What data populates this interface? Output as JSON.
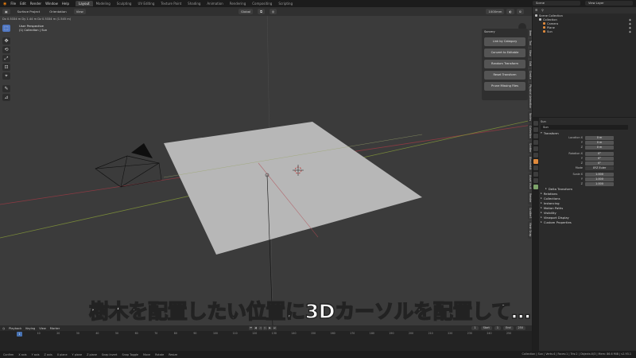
{
  "app": {
    "menu": [
      "File",
      "Edit",
      "Render",
      "Window",
      "Help"
    ],
    "workspaces": [
      "Layout",
      "Modeling",
      "Sculpting",
      "UV Editing",
      "Texture Paint",
      "Shading",
      "Animation",
      "Rendering",
      "Compositing",
      "Scripting"
    ],
    "active_workspace": "Layout",
    "scene_field": "Scene",
    "view_layer_field": "View Layer"
  },
  "viewport": {
    "header": {
      "surface_project": "Surface Project",
      "orientation_label": "Orientation",
      "view": "View",
      "transform_orientation": "Global",
      "snap_value": "1000mm"
    },
    "subheader": "Dx 0.5334 m  Dy 1.44 m  Dz 0.5334 m (1.545 m)",
    "info": {
      "perspective": "User Perspective",
      "collection": "(1) Collection | Sun"
    },
    "tools": [
      "⬚",
      "✥",
      "⟲",
      "⤢",
      "⊡",
      "⌖",
      "✎",
      "⊿"
    ],
    "npanel": {
      "title": "Sorcery",
      "buttons": [
        "Link by Category",
        "Convert to Editable",
        "Random Transform",
        "Reset Transform",
        "Prune Missing Files"
      ]
    },
    "sidetabs": [
      "Item",
      "Tool",
      "View",
      "Edit",
      "Create",
      "Physical Animation",
      "Nodes",
      "Collection",
      "Scatter",
      "Blenderkit",
      "Asset Vault",
      "Render",
      "Scatter5",
      "Mesh Snap"
    ],
    "caption": "樹木を配置したい位置に3Dカーソルを配置して…"
  },
  "timeline": {
    "menu": [
      "Playback",
      "Keying",
      "View",
      "Marker"
    ],
    "current_frame": "1",
    "start_label": "Start",
    "start": "1",
    "end_label": "End",
    "end": "250",
    "ticks": [
      "0",
      "10",
      "20",
      "30",
      "40",
      "50",
      "60",
      "70",
      "80",
      "90",
      "100",
      "110",
      "120",
      "130",
      "140",
      "150",
      "160",
      "170",
      "180",
      "190",
      "200",
      "210",
      "220",
      "230",
      "240",
      "250"
    ]
  },
  "status": {
    "items": [
      "Confirm",
      "X axis",
      "Y axis",
      "Z axis",
      "X plane",
      "Y plane",
      "Z plane",
      "Snap Invert",
      "Snap Toggle",
      "Move",
      "Rotate",
      "Resize"
    ],
    "version": "Collection | Sun | Verts:4 | Faces:1 | Tris:2 | Objects:0/3 | Mem: 86.6 MiB | v2.93.1"
  },
  "outliner": {
    "header": "Scene Collection",
    "rows": [
      {
        "label": "Collection",
        "color": "#bdbdbd",
        "indent": 1
      },
      {
        "label": "Camera",
        "color": "#e08a3c",
        "indent": 2
      },
      {
        "label": "Plane",
        "color": "#e08a3c",
        "indent": 2
      },
      {
        "label": "Sun",
        "color": "#e08a3c",
        "indent": 2
      }
    ]
  },
  "properties": {
    "object_name": "Sun",
    "sub_name": "Sun",
    "transform_section": "Transform",
    "location": {
      "label": "Location X",
      "y": "Y",
      "z": "Z",
      "vx": "0 m",
      "vy": "0 m",
      "vz": "0 m"
    },
    "rotation": {
      "label": "Rotation X",
      "y": "Y",
      "z": "Z",
      "vx": "0°",
      "vy": "0°",
      "vz": "0°"
    },
    "mode": {
      "label": "Mode",
      "value": "XYZ Euler"
    },
    "scale": {
      "label": "Scale X",
      "y": "Y",
      "z": "Z",
      "vx": "1.000",
      "vy": "1.000",
      "vz": "1.000"
    },
    "sections": [
      "Delta Transform",
      "Relations",
      "Collections",
      "Instancing",
      "Motion Paths",
      "Visibility",
      "Viewport Display",
      "Custom Properties"
    ]
  },
  "colors": {
    "accent": "#4772b3",
    "viewport_bg": "#3b3b3b",
    "plane": "#b7b7b7",
    "x_axis": "#a0404a",
    "y_axis": "#8aa040"
  }
}
